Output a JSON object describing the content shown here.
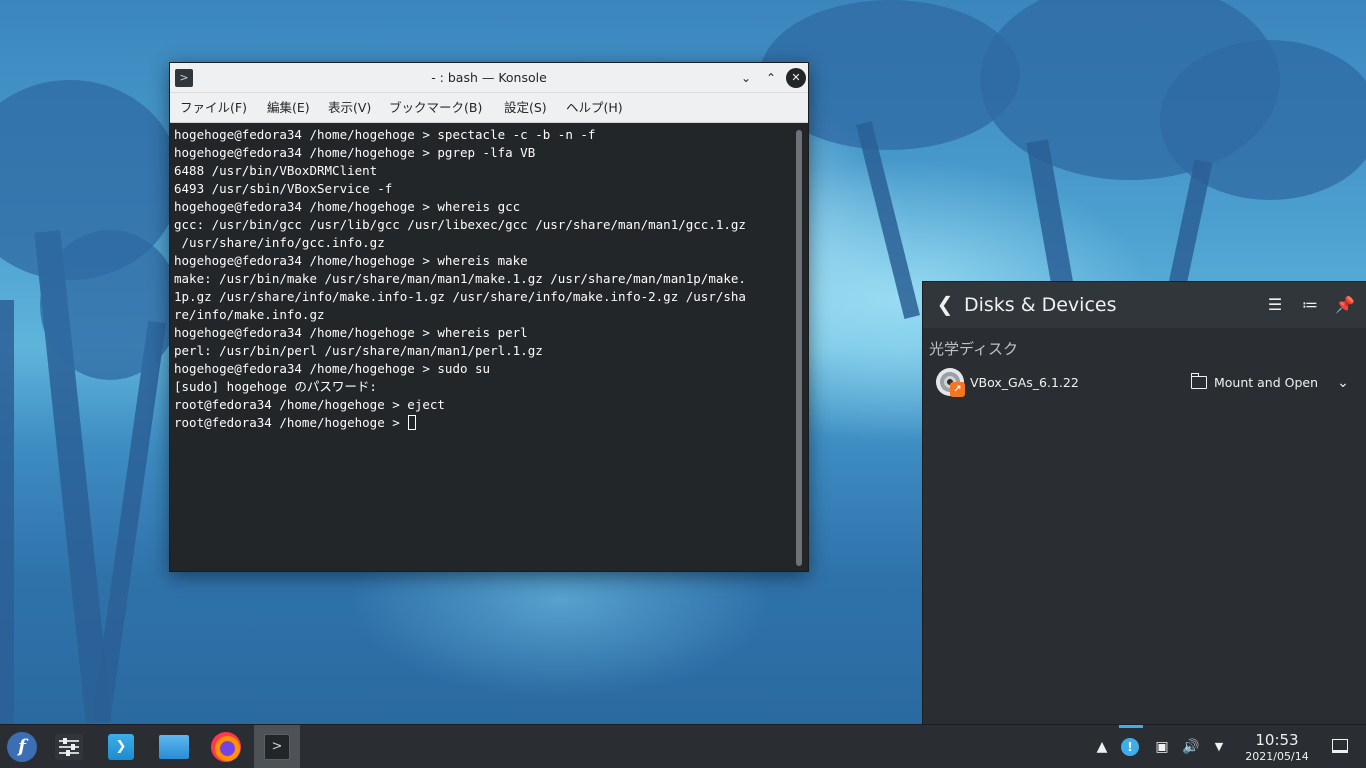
{
  "colors": {
    "accent": "#3daee9",
    "terminal_bg": "#232629",
    "panel_bg": "#2a2e32",
    "titlebar_bg": "#eff0f1"
  },
  "window": {
    "title": "- : bash — Konsole",
    "app_icon": "konsole-icon"
  },
  "menu": {
    "items": [
      "ファイル(F)",
      "編集(E)",
      "表示(V)",
      "ブックマーク(B)",
      "設定(S)",
      "ヘルプ(H)"
    ]
  },
  "terminal": {
    "lines": [
      "hogehoge@fedora34 /home/hogehoge > spectacle -c -b -n -f",
      "hogehoge@fedora34 /home/hogehoge > pgrep -lfa VB",
      "6488 /usr/bin/VBoxDRMClient",
      "6493 /usr/sbin/VBoxService -f",
      "hogehoge@fedora34 /home/hogehoge > whereis gcc",
      "gcc: /usr/bin/gcc /usr/lib/gcc /usr/libexec/gcc /usr/share/man/man1/gcc.1.gz",
      " /usr/share/info/gcc.info.gz",
      "hogehoge@fedora34 /home/hogehoge > whereis make",
      "make: /usr/bin/make /usr/share/man/man1/make.1.gz /usr/share/man/man1p/make.",
      "1p.gz /usr/share/info/make.info-1.gz /usr/share/info/make.info-2.gz /usr/sha",
      "re/info/make.info.gz",
      "hogehoge@fedora34 /home/hogehoge > whereis perl",
      "perl: /usr/bin/perl /usr/share/man/man1/perl.1.gz",
      "hogehoge@fedora34 /home/hogehoge > sudo su",
      "[sudo] hogehoge のパスワード:",
      "root@fedora34 /home/hogehoge > eject",
      "root@fedora34 /home/hogehoge > "
    ]
  },
  "devices": {
    "title": "Disks & Devices",
    "section": "光学ディスク",
    "device_name": "VBox_GAs_6.1.22",
    "action": "Mount and Open"
  },
  "taskbar": {
    "tasks": [
      "application-launcher",
      "system-settings",
      "discover",
      "dolphin-files",
      "firefox",
      "konsole"
    ],
    "clock_time": "10:53",
    "clock_date": "2021/05/14"
  }
}
